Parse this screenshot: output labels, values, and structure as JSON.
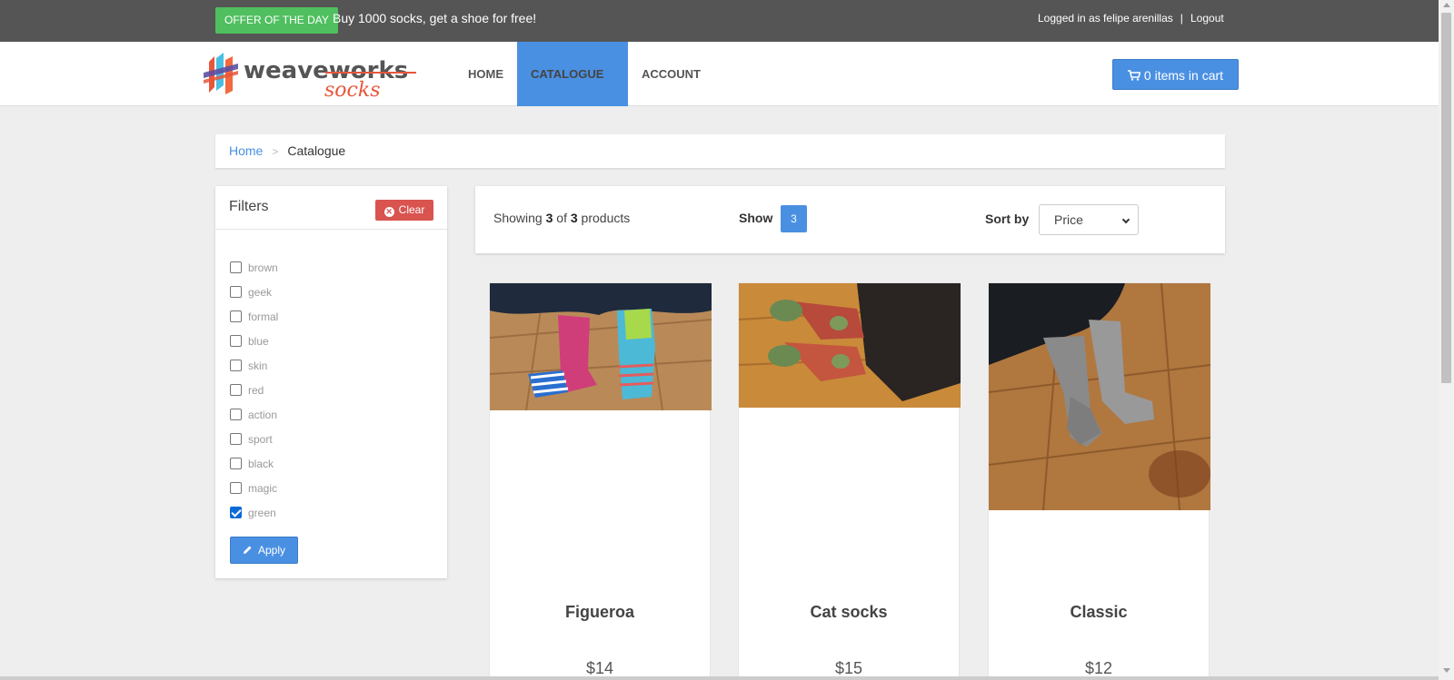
{
  "topbar": {
    "offer_label": "OFFER OF THE DAY",
    "offer_text": "Buy 1000 socks, get a shoe for free!",
    "logged_in": "Logged in as felipe arenillas",
    "separator": "|",
    "logout": "Logout"
  },
  "logo": {
    "brand_top": "weaveworks",
    "brand_bottom": "socks"
  },
  "nav": {
    "home": "HOME",
    "catalogue": "CATALOGUE",
    "account": "ACCOUNT",
    "cart": "0 items in cart"
  },
  "breadcrumb": {
    "home": "Home",
    "separator": ">",
    "current": "Catalogue"
  },
  "filters": {
    "title": "Filters",
    "clear": "Clear",
    "apply": "Apply",
    "items": [
      {
        "label": "brown",
        "checked": false
      },
      {
        "label": "geek",
        "checked": false
      },
      {
        "label": "formal",
        "checked": false
      },
      {
        "label": "blue",
        "checked": false
      },
      {
        "label": "skin",
        "checked": false
      },
      {
        "label": "red",
        "checked": false
      },
      {
        "label": "action",
        "checked": false
      },
      {
        "label": "sport",
        "checked": false
      },
      {
        "label": "black",
        "checked": false
      },
      {
        "label": "magic",
        "checked": false
      },
      {
        "label": "green",
        "checked": true
      }
    ]
  },
  "toolbar": {
    "showing_prefix": "Showing",
    "showing_count": "3",
    "showing_of": "of",
    "showing_total": "3",
    "showing_suffix": "products",
    "show_label": "Show",
    "show_value": "3",
    "sort_label": "Sort by",
    "sort_value": "Price"
  },
  "products": [
    {
      "name": "Figueroa",
      "price": "$14"
    },
    {
      "name": "Cat socks",
      "price": "$15"
    },
    {
      "name": "Classic",
      "price": "$12"
    }
  ],
  "colors": {
    "accent": "#4a90e2",
    "offer": "#4fbf5f",
    "danger": "#d9534f",
    "topbar": "#555555"
  }
}
